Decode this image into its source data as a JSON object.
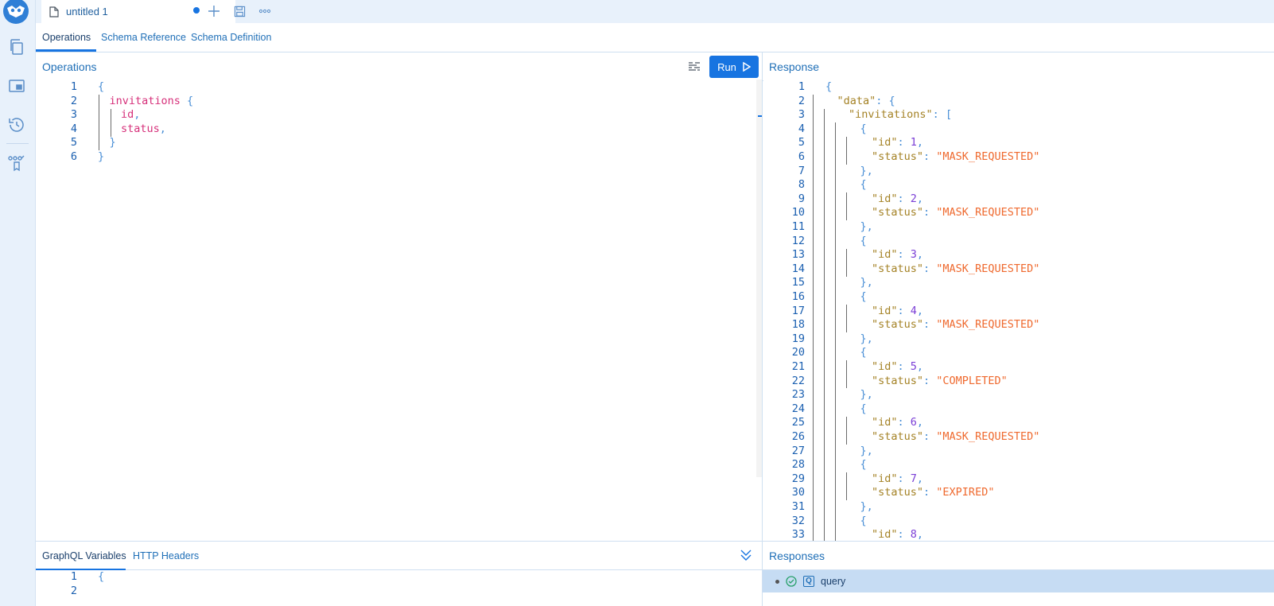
{
  "file_tab": {
    "title": "untitled 1"
  },
  "subtabs": [
    "Operations",
    "Schema Reference",
    "Schema Definition"
  ],
  "operations_panel": {
    "title": "Operations",
    "run_label": "Run"
  },
  "response_panel": {
    "title": "Response"
  },
  "operations_code": [
    {
      "n": "1",
      "parts": [
        [
          "c-brace",
          "{"
        ]
      ]
    },
    {
      "n": "2",
      "parts": [
        [
          "c-field",
          "invitations"
        ],
        [
          "c-brace",
          " {"
        ]
      ]
    },
    {
      "n": "3",
      "parts": [
        [
          "c-field",
          "id"
        ],
        [
          "c-punct",
          ","
        ]
      ]
    },
    {
      "n": "4",
      "parts": [
        [
          "c-field",
          "status"
        ],
        [
          "c-punct",
          ","
        ]
      ]
    },
    {
      "n": "5",
      "parts": [
        [
          "c-brace",
          "}"
        ]
      ]
    },
    {
      "n": "6",
      "parts": [
        [
          "c-brace",
          "}"
        ]
      ]
    }
  ],
  "response_code": [
    {
      "n": "1",
      "parts": [
        [
          "c-brace",
          "{"
        ]
      ]
    },
    {
      "n": "2",
      "parts": [
        [
          "c-key",
          "\"data\""
        ],
        [
          "c-punct",
          ": "
        ],
        [
          "c-brace",
          "{"
        ]
      ]
    },
    {
      "n": "3",
      "parts": [
        [
          "c-key",
          "\"invitations\""
        ],
        [
          "c-punct",
          ": "
        ],
        [
          "c-brace",
          "["
        ]
      ]
    },
    {
      "n": "4",
      "parts": [
        [
          "c-brace",
          "{"
        ]
      ]
    },
    {
      "n": "5",
      "parts": [
        [
          "c-key",
          "\"id\""
        ],
        [
          "c-punct",
          ": "
        ],
        [
          "c-num",
          "1"
        ],
        [
          "c-punct",
          ","
        ]
      ]
    },
    {
      "n": "6",
      "parts": [
        [
          "c-key",
          "\"status\""
        ],
        [
          "c-punct",
          ": "
        ],
        [
          "c-str",
          "\"MASK_REQUESTED\""
        ]
      ]
    },
    {
      "n": "7",
      "parts": [
        [
          "c-brace",
          "},"
        ]
      ]
    },
    {
      "n": "8",
      "parts": [
        [
          "c-brace",
          "{"
        ]
      ]
    },
    {
      "n": "9",
      "parts": [
        [
          "c-key",
          "\"id\""
        ],
        [
          "c-punct",
          ": "
        ],
        [
          "c-num",
          "2"
        ],
        [
          "c-punct",
          ","
        ]
      ]
    },
    {
      "n": "10",
      "parts": [
        [
          "c-key",
          "\"status\""
        ],
        [
          "c-punct",
          ": "
        ],
        [
          "c-str",
          "\"MASK_REQUESTED\""
        ]
      ]
    },
    {
      "n": "11",
      "parts": [
        [
          "c-brace",
          "},"
        ]
      ]
    },
    {
      "n": "12",
      "parts": [
        [
          "c-brace",
          "{"
        ]
      ]
    },
    {
      "n": "13",
      "parts": [
        [
          "c-key",
          "\"id\""
        ],
        [
          "c-punct",
          ": "
        ],
        [
          "c-num",
          "3"
        ],
        [
          "c-punct",
          ","
        ]
      ]
    },
    {
      "n": "14",
      "parts": [
        [
          "c-key",
          "\"status\""
        ],
        [
          "c-punct",
          ": "
        ],
        [
          "c-str",
          "\"MASK_REQUESTED\""
        ]
      ]
    },
    {
      "n": "15",
      "parts": [
        [
          "c-brace",
          "},"
        ]
      ]
    },
    {
      "n": "16",
      "parts": [
        [
          "c-brace",
          "{"
        ]
      ]
    },
    {
      "n": "17",
      "parts": [
        [
          "c-key",
          "\"id\""
        ],
        [
          "c-punct",
          ": "
        ],
        [
          "c-num",
          "4"
        ],
        [
          "c-punct",
          ","
        ]
      ]
    },
    {
      "n": "18",
      "parts": [
        [
          "c-key",
          "\"status\""
        ],
        [
          "c-punct",
          ": "
        ],
        [
          "c-str",
          "\"MASK_REQUESTED\""
        ]
      ]
    },
    {
      "n": "19",
      "parts": [
        [
          "c-brace",
          "},"
        ]
      ]
    },
    {
      "n": "20",
      "parts": [
        [
          "c-brace",
          "{"
        ]
      ]
    },
    {
      "n": "21",
      "parts": [
        [
          "c-key",
          "\"id\""
        ],
        [
          "c-punct",
          ": "
        ],
        [
          "c-num",
          "5"
        ],
        [
          "c-punct",
          ","
        ]
      ]
    },
    {
      "n": "22",
      "parts": [
        [
          "c-key",
          "\"status\""
        ],
        [
          "c-punct",
          ": "
        ],
        [
          "c-str",
          "\"COMPLETED\""
        ]
      ]
    },
    {
      "n": "23",
      "parts": [
        [
          "c-brace",
          "},"
        ]
      ]
    },
    {
      "n": "24",
      "parts": [
        [
          "c-brace",
          "{"
        ]
      ]
    },
    {
      "n": "25",
      "parts": [
        [
          "c-key",
          "\"id\""
        ],
        [
          "c-punct",
          ": "
        ],
        [
          "c-num",
          "6"
        ],
        [
          "c-punct",
          ","
        ]
      ]
    },
    {
      "n": "26",
      "parts": [
        [
          "c-key",
          "\"status\""
        ],
        [
          "c-punct",
          ": "
        ],
        [
          "c-str",
          "\"MASK_REQUESTED\""
        ]
      ]
    },
    {
      "n": "27",
      "parts": [
        [
          "c-brace",
          "},"
        ]
      ]
    },
    {
      "n": "28",
      "parts": [
        [
          "c-brace",
          "{"
        ]
      ]
    },
    {
      "n": "29",
      "parts": [
        [
          "c-key",
          "\"id\""
        ],
        [
          "c-punct",
          ": "
        ],
        [
          "c-num",
          "7"
        ],
        [
          "c-punct",
          ","
        ]
      ]
    },
    {
      "n": "30",
      "parts": [
        [
          "c-key",
          "\"status\""
        ],
        [
          "c-punct",
          ": "
        ],
        [
          "c-str",
          "\"EXPIRED\""
        ]
      ]
    },
    {
      "n": "31",
      "parts": [
        [
          "c-brace",
          "},"
        ]
      ]
    },
    {
      "n": "32",
      "parts": [
        [
          "c-brace",
          "{"
        ]
      ]
    },
    {
      "n": "33",
      "parts": [
        [
          "c-key",
          "\"id\""
        ],
        [
          "c-punct",
          ": "
        ],
        [
          "c-num",
          "8"
        ],
        [
          "c-punct",
          ","
        ]
      ]
    }
  ],
  "bottom_tabs": [
    "GraphQL Variables",
    "HTTP Headers"
  ],
  "variables_code": [
    {
      "n": "1",
      "parts": [
        [
          "c-brace",
          "{"
        ]
      ]
    },
    {
      "n": "2",
      "parts": []
    }
  ],
  "responses": {
    "title": "Responses",
    "items": [
      {
        "label": "query"
      }
    ]
  }
}
